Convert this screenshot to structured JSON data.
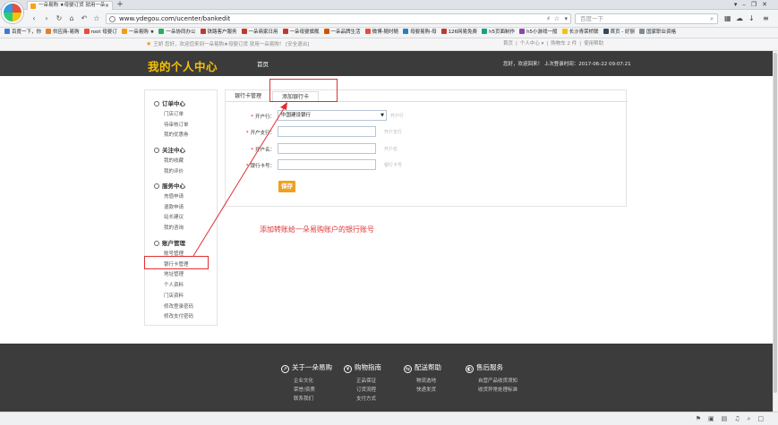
{
  "browser": {
    "tab_title": "一朵易购 ★母婴订货 就用一朵",
    "url": "www.ydegou.com/ucenter/bankedit",
    "search_placeholder": "百度一下",
    "bookmarks": [
      "百度一下，你",
      "供应商-易购",
      "root 母婴订",
      "一朵易购 ★",
      "一朵协同办公",
      "铁路客户服务",
      "一朵商家日用",
      "一朵母婴旗舰",
      "一朵品牌生活",
      "微博-随时随",
      "母婴易购-母",
      "126网易免费",
      "h5页面制作",
      "h5小游戏一般",
      "长沙青荣桥联",
      "首页 - 好厨",
      "国家职业资格"
    ]
  },
  "site": {
    "welcome": "王娇 您好，欢迎您来到一朵易购★母婴订货 就用一朵易购！ [安全退出]",
    "top_links": [
      "首页",
      "个人中心 ▾",
      "购物车 2 件",
      "使用帮助"
    ],
    "brand": "我的个人中心",
    "nav_home": "首页",
    "header_info": "您好，欢迎回来！  上次登录时间：2017-06-22 09:07:21"
  },
  "sidebar": {
    "groups": [
      {
        "title": "订单中心",
        "items": [
          "门店订单",
          "待审核订单",
          "我的优惠券"
        ]
      },
      {
        "title": "关注中心",
        "items": [
          "我的收藏",
          "我的评价"
        ]
      },
      {
        "title": "服务中心",
        "items": [
          "充值申请",
          "退款申请",
          "站长建议",
          "我的咨询"
        ]
      },
      {
        "title": "账户管理",
        "items": [
          "账号管理",
          "银行卡管理",
          "地址管理",
          "个人资料",
          "门店资料",
          "修改登录密码",
          "修改支付密码"
        ]
      }
    ]
  },
  "content": {
    "tabs": [
      "银行卡管理",
      "添加银行卡"
    ],
    "fields": [
      {
        "label": "开户行：",
        "value": "中国建设银行",
        "hint": "开户行"
      },
      {
        "label": "开户支行：",
        "value": "",
        "hint": "开户支行"
      },
      {
        "label": "开户名：",
        "value": "",
        "hint": "开户名"
      },
      {
        "label": "银行卡号：",
        "value": "",
        "hint": "银行卡号"
      }
    ],
    "save_label": "保存"
  },
  "annotation": {
    "text": "添加转账给一朵易购账户的银行账号",
    "color": "#e03030"
  },
  "footer": {
    "columns": [
      {
        "title": "关于一朵易购",
        "icon": "compass",
        "links": [
          "企业文化",
          "荣誉/资质",
          "联系我们"
        ]
      },
      {
        "title": "购物指南",
        "icon": "yuan",
        "links": [
          "正品保证",
          "订货流程",
          "支付方式"
        ]
      },
      {
        "title": "配送帮助",
        "icon": "truck",
        "links": [
          "物流选地",
          "快递发货"
        ]
      },
      {
        "title": "售后服务",
        "icon": "shield",
        "links": [
          "自营产品收货须知",
          "收货异常处理标准"
        ]
      }
    ]
  },
  "colors": {
    "header_bg": "#3b3b3b",
    "brand_yellow": "#f7c200",
    "save_orange": "#f0a020",
    "required_red": "#e00000"
  }
}
